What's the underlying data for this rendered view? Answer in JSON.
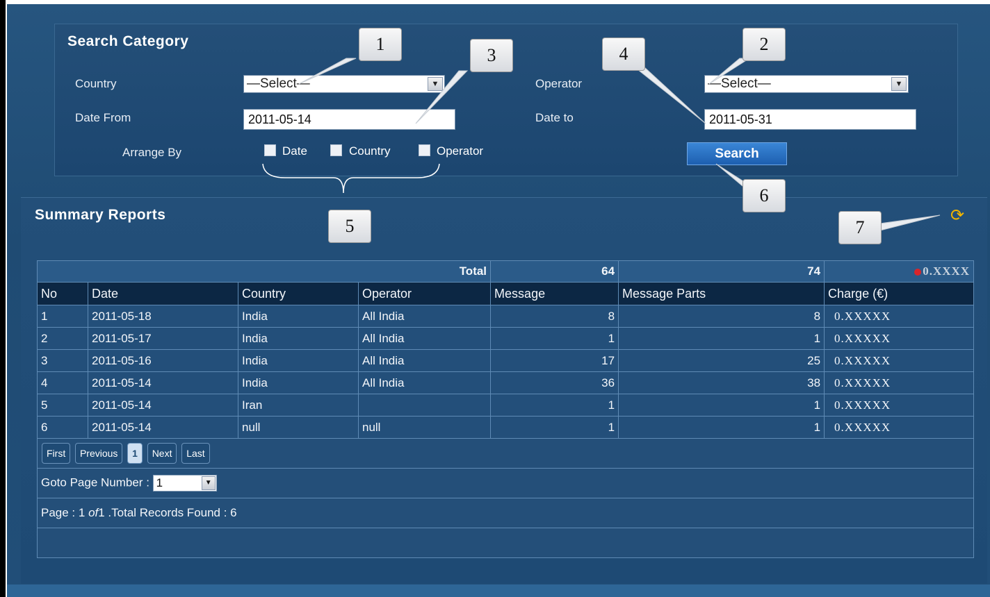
{
  "search": {
    "title": "Search Category",
    "country_label": "Country",
    "country_value": "—Select—",
    "operator_label": "Operator",
    "operator_value": "—Select—",
    "date_from_label": "Date From",
    "date_from_value": "2011-05-14",
    "date_to_label": "Date to",
    "date_to_value": "2011-05-31",
    "arrange_label": "Arrange By",
    "arrange_options": [
      "Date",
      "Country",
      "Operator"
    ],
    "search_button": "Search"
  },
  "callouts": [
    "1",
    "2",
    "3",
    "4",
    "5",
    "6",
    "7"
  ],
  "summary": {
    "title": "Summary Reports",
    "totals": {
      "label": "Total",
      "message": "64",
      "parts": "74",
      "charge": "0.XXXX"
    },
    "columns": [
      "No",
      "Date",
      "Country",
      "Operator",
      "Message",
      "Message Parts",
      "Charge (€)"
    ],
    "rows": [
      [
        "1",
        "2011-05-18",
        "India",
        "All India",
        "8",
        "8",
        "0.XXXXX"
      ],
      [
        "2",
        "2011-05-17",
        "India",
        "All India",
        "1",
        "1",
        "0.XXXXX"
      ],
      [
        "3",
        "2011-05-16",
        "India",
        "All India",
        "17",
        "25",
        "0.XXXXX"
      ],
      [
        "4",
        "2011-05-14",
        "India",
        "All India",
        "36",
        "38",
        "0.XXXXX"
      ],
      [
        "5",
        "2011-05-14",
        "Iran",
        "",
        "1",
        "1",
        "0.XXXXX"
      ],
      [
        "6",
        "2011-05-14",
        "null",
        "null",
        "1",
        "1",
        "0.XXXXX"
      ]
    ],
    "pager": {
      "first": "First",
      "previous": "Previous",
      "current": "1",
      "next": "Next",
      "last": "Last"
    },
    "goto_label": "Goto Page Number :",
    "goto_value": "1",
    "status_prefix": "Page : 1 ",
    "status_of": "of",
    "status_suffix": "1 .Total Records Found : 6"
  },
  "icons": {
    "refresh": "refresh-icon",
    "dropdown": "chevron-down-icon",
    "charge_dot": "red-dot-icon"
  },
  "colors": {
    "background": "#214e78",
    "header_row": "#0c2744",
    "accent_button": "#2a72c4",
    "refresh": "#f0b400"
  }
}
